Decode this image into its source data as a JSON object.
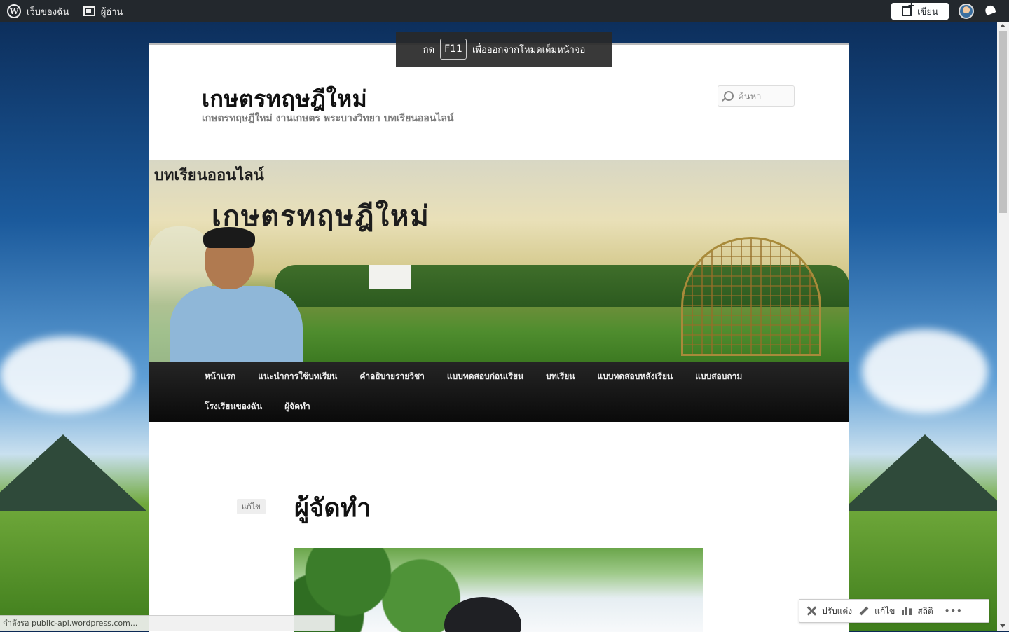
{
  "adminbar": {
    "my_sites": "เว็บของฉัน",
    "reader": "ผู้อ่าน",
    "write": "เขียน"
  },
  "fullscreen_notice": {
    "prefix": "กด",
    "key": "F11",
    "suffix": "เพื่อออกจากโหมดเต็มหน้าจอ"
  },
  "site": {
    "title": "เกษตรทฤษฎีใหม่",
    "description": "เกษตรทฤษฎีใหม่ งานเกษตร พระบางวิทยา บทเรียนออนไลน์",
    "search_placeholder": "ค้นหา"
  },
  "banner": {
    "small_text": "บทเรียนออนไลน์",
    "big_text": "เกษตรทฤษฎีใหม่"
  },
  "nav": {
    "row1": [
      "หน้าแรก",
      "แนะนำการใช้บทเรียน",
      "คำอธิบายรายวิชา",
      "แบบทดสอบก่อนเรียน",
      "บทเรียน",
      "แบบทดสอบหลังเรียน",
      "แบบสอบถาม"
    ],
    "row2": [
      "โรงเรียนของฉัน",
      "ผู้จัดทำ"
    ]
  },
  "entry": {
    "edit_label": "แก้ไข",
    "title": "ผู้จัดทำ"
  },
  "statusbar": {
    "text": "กำลังรอ public-api.wordpress.com..."
  },
  "actionbar": {
    "customize": "ปรับแต่ง",
    "edit": "แก้ไข",
    "stats": "สถิติ",
    "more": "•••"
  }
}
